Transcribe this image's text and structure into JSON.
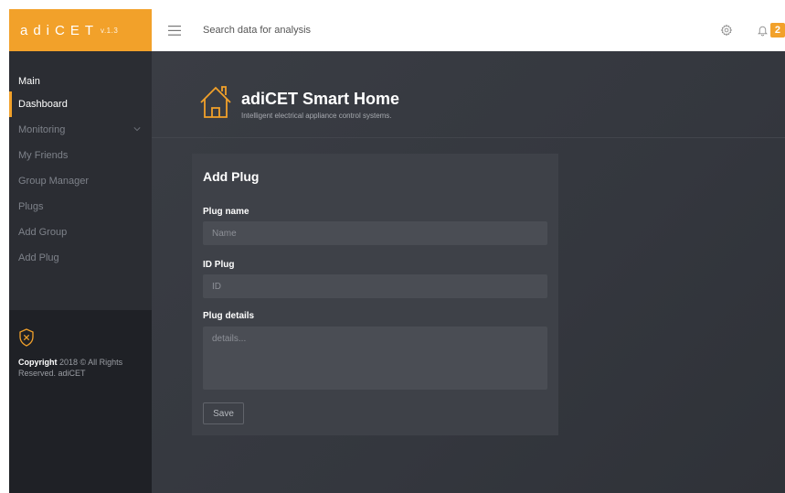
{
  "brand": {
    "name": "adiCET",
    "version": "v.1.3"
  },
  "topbar": {
    "search_placeholder": "Search data for analysis",
    "notification_count": "2"
  },
  "sidebar": {
    "heading": "Main",
    "items": [
      {
        "label": "Dashboard",
        "active": true
      },
      {
        "label": "Monitoring",
        "has_submenu": true
      },
      {
        "label": "My Friends"
      },
      {
        "label": "Group Manager"
      },
      {
        "label": "Plugs"
      },
      {
        "label": "Add Group"
      },
      {
        "label": "Add Plug"
      }
    ],
    "footer": {
      "copyright_bold": "Copyright",
      "copyright_text": "2018 © All Rights Reserved. adiCET"
    }
  },
  "header": {
    "title": "adiCET Smart Home",
    "subtitle": "Intelligent electrical appliance control systems."
  },
  "form": {
    "title": "Add Plug",
    "plug_name_label": "Plug name",
    "plug_name_placeholder": "Name",
    "id_label": "ID Plug",
    "id_placeholder": "ID",
    "details_label": "Plug details",
    "details_placeholder": "details...",
    "save_label": "Save"
  },
  "colors": {
    "accent": "#f2a12a",
    "sidebar": "#2b2d33",
    "main_bg": "#37393f",
    "card": "#3e4148"
  }
}
